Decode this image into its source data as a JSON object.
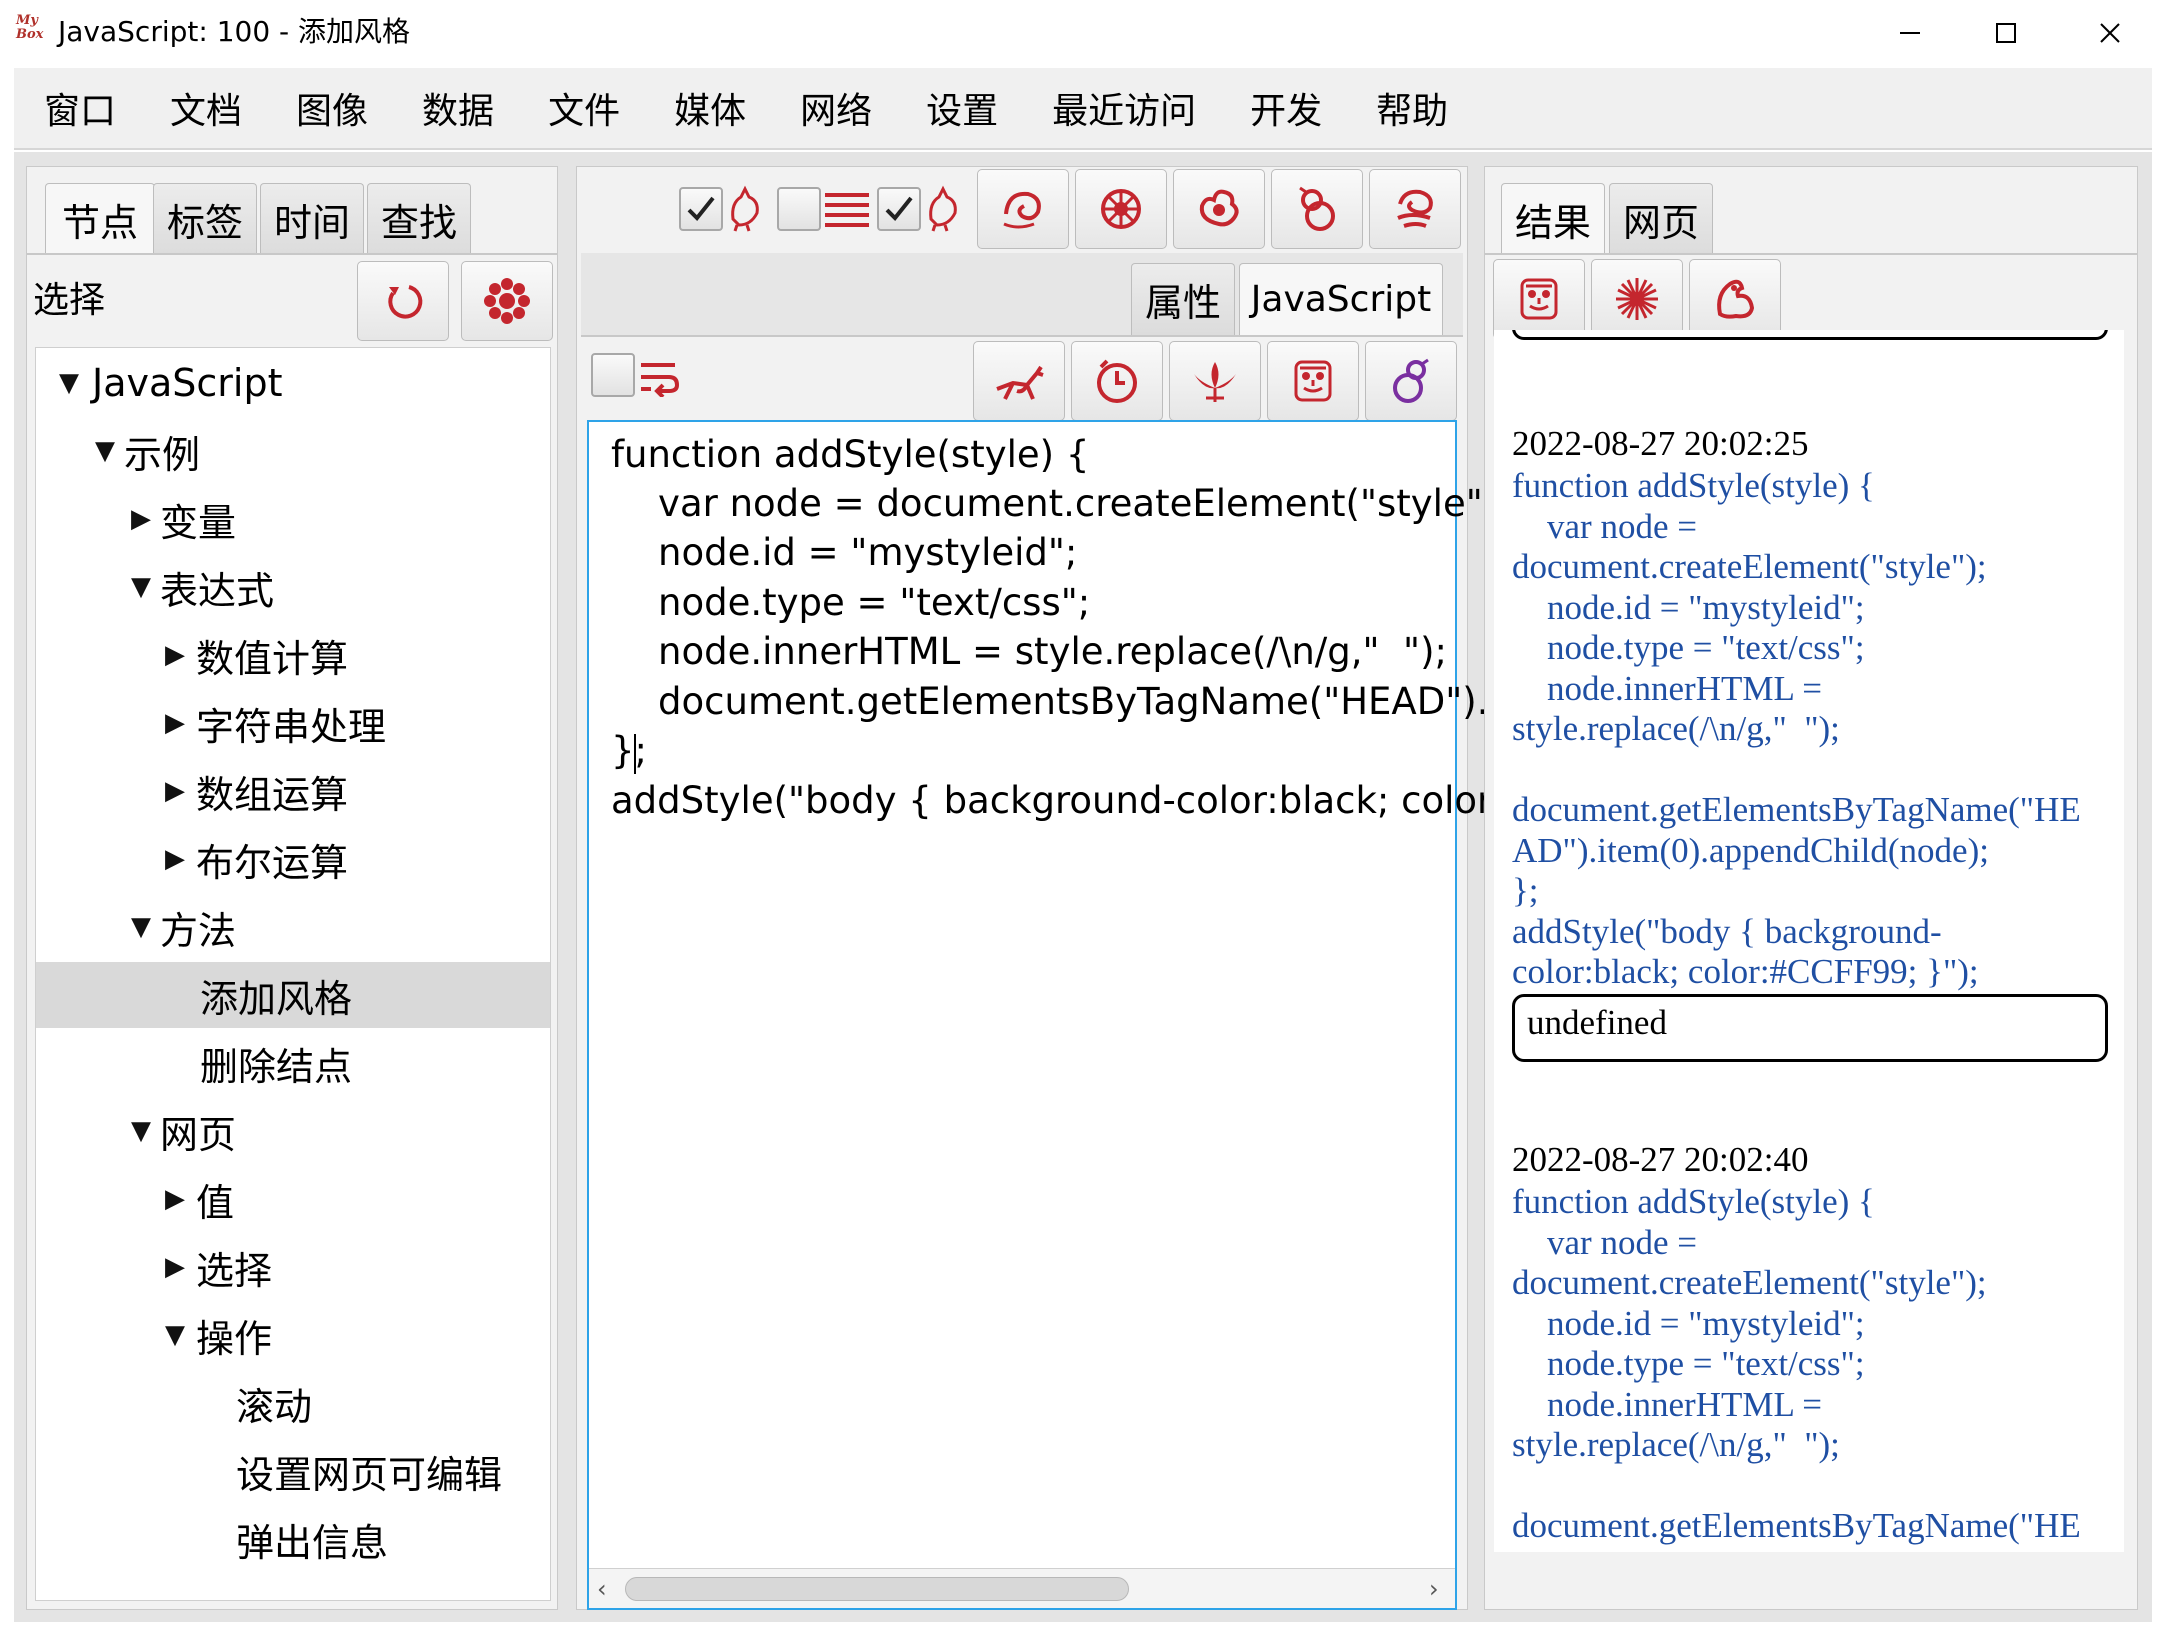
{
  "window": {
    "title": "JavaScript: 100 - 添加风格",
    "logo_text": "My Box",
    "controls": [
      "minimize",
      "maximize",
      "close"
    ]
  },
  "menubar": [
    "窗口",
    "文档",
    "图像",
    "数据",
    "文件",
    "媒体",
    "网络",
    "设置",
    "最近访问",
    "开发",
    "帮助"
  ],
  "left_panel": {
    "tabs": [
      "节点",
      "标签",
      "时间",
      "查找"
    ],
    "active_tab": "节点",
    "select_label": "选择",
    "buttons": [
      "refresh-icon",
      "flower-icon"
    ],
    "tree": [
      {
        "label": "JavaScript",
        "level": 0,
        "state": "expanded"
      },
      {
        "label": "示例",
        "level": 1,
        "state": "expanded"
      },
      {
        "label": "变量",
        "level": 2,
        "state": "collapsed"
      },
      {
        "label": "表达式",
        "level": 2,
        "state": "expanded"
      },
      {
        "label": "数值计算",
        "level": 3,
        "state": "collapsed"
      },
      {
        "label": "字符串处理",
        "level": 3,
        "state": "collapsed"
      },
      {
        "label": "数组运算",
        "level": 3,
        "state": "collapsed"
      },
      {
        "label": "布尔运算",
        "level": 3,
        "state": "collapsed"
      },
      {
        "label": "方法",
        "level": 2,
        "state": "expanded"
      },
      {
        "label": "添加风格",
        "level": 3,
        "state": "leaf",
        "selected": true
      },
      {
        "label": "删除结点",
        "level": 3,
        "state": "leaf"
      },
      {
        "label": "网页",
        "level": 2,
        "state": "expanded"
      },
      {
        "label": "值",
        "level": 3,
        "state": "collapsed"
      },
      {
        "label": "选择",
        "level": 3,
        "state": "collapsed"
      },
      {
        "label": "操作",
        "level": 3,
        "state": "expanded"
      },
      {
        "label": "滚动",
        "level": 4,
        "state": "leaf"
      },
      {
        "label": "设置网页可编辑",
        "level": 4,
        "state": "leaf"
      },
      {
        "label": "弹出信息",
        "level": 4,
        "state": "leaf"
      }
    ]
  },
  "center_panel": {
    "top_toolbar_icons": [
      "rooster-icon",
      "lines-icon",
      "rooster-icon",
      "swirl-icon",
      "flower-icon",
      "peony-icon",
      "gourd-icon",
      "cloud-icon"
    ],
    "checkbox_states": [
      true,
      false,
      true
    ],
    "tabs": [
      "属性",
      "JavaScript"
    ],
    "active_tab": "JavaScript",
    "editor_toolbar_icons": [
      "wrap-icon",
      "deer-icon",
      "clock-icon",
      "lotus-icon",
      "mask-icon",
      "gourd-icon"
    ],
    "code_lines": [
      "function addStyle(style) {",
      "    var node = document.createElement(\"style\");",
      "    node.id = \"mystyleid\";",
      "    node.type = \"text/css\";",
      "    node.innerHTML = style.replace(/\\n/g,\"  \");",
      "    document.getElementsByTagName(\"HEAD\").ite",
      "};",
      "addStyle(\"body { background-color:black; color:#"
    ]
  },
  "right_panel": {
    "tabs": [
      "结果",
      "网页"
    ],
    "active_tab": "结果",
    "toolbar_icons": [
      "mask-icon",
      "flower-icon",
      "bird-icon"
    ],
    "results": [
      {
        "timestamp": "2022-08-27 20:02:25",
        "code": "function addStyle(style) {\n    var node =\ndocument.createElement(\"style\");\n    node.id = \"mystyleid\";\n    node.type = \"text/css\";\n    node.innerHTML =\nstyle.replace(/\\n/g,\"  \");\n\ndocument.getElementsByTagName(\"HE\nAD\").item(0).appendChild(node);\n};\naddStyle(\"body { background-\ncolor:black; color:#CCFF99; }\");",
        "output": "undefined"
      },
      {
        "timestamp": "2022-08-27 20:02:40",
        "code": "function addStyle(style) {\n    var node =\ndocument.createElement(\"style\");\n    node.id = \"mystyleid\";\n    node.type = \"text/css\";\n    node.innerHTML =\nstyle.replace(/\\n/g,\"  \");\n\ndocument.getElementsByTagName(\"HE"
      }
    ]
  },
  "colors": {
    "icon_red": "#c4262e",
    "focus_blue": "#2ea3e8",
    "result_code_blue": "#1f4fa3"
  }
}
